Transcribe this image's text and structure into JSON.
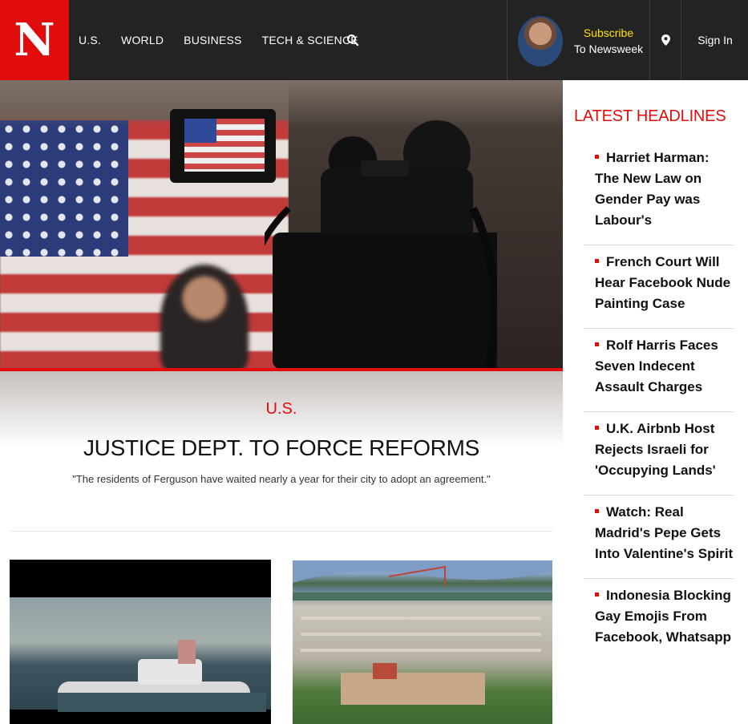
{
  "brand": {
    "logo_letter": "N",
    "accent": "#e10d0d"
  },
  "nav": {
    "items": [
      {
        "label": "U.S."
      },
      {
        "label": "WORLD"
      },
      {
        "label": "BUSINESS"
      },
      {
        "label": "TECH & SCIENCE"
      }
    ],
    "search_icon": "search-icon"
  },
  "subscribe": {
    "line1": "Subscribe",
    "line2": "To Newsweek"
  },
  "signin": {
    "label": "Sign In"
  },
  "hero": {
    "section": "U.S.",
    "headline": "JUSTICE DEPT. TO FORCE REFORMS",
    "dek": "\"The residents of Ferguson have waited nearly a year for their city to adopt an agreement.\""
  },
  "sidebar": {
    "title": "LATEST HEADLINES",
    "items": [
      {
        "text": "Harriet Harman: The New Law on Gender Pay was Labour's"
      },
      {
        "text": "French Court Will Hear Facebook Nude Painting Case"
      },
      {
        "text": "Rolf Harris Faces Seven Indecent Assault Charges"
      },
      {
        "text": "U.K. Airbnb Host Rejects Israeli for 'Occupying Lands'"
      },
      {
        "text": "Watch: Real Madrid's Pepe Gets Into Valentine's Spirit"
      },
      {
        "text": "Indonesia Blocking Gay Emojis From Facebook, Whatsapp"
      }
    ]
  }
}
